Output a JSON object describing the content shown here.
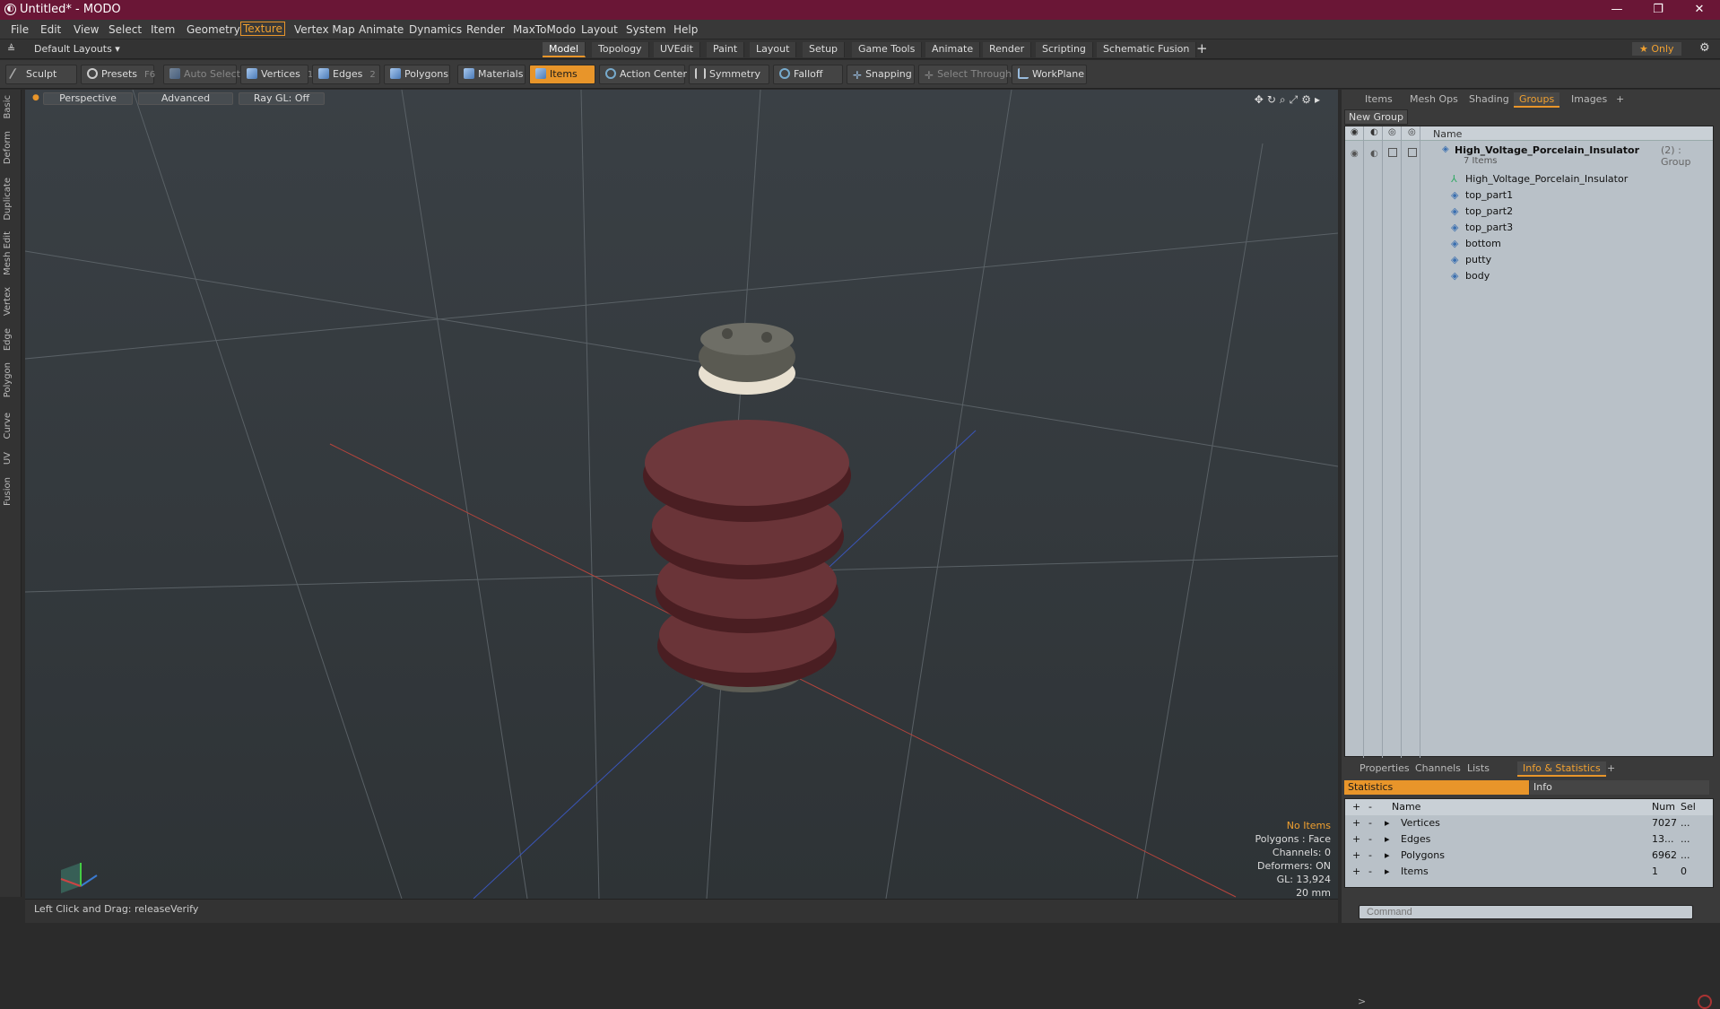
{
  "window": {
    "title": "Untitled* - MODO",
    "min": "—",
    "max": "❐",
    "close": "✕"
  },
  "menu": [
    "File",
    "Edit",
    "View",
    "Select",
    "Item",
    "Geometry",
    "Texture",
    "Vertex Map",
    "Animate",
    "Dynamics",
    "Render",
    "MaxToModo",
    "Layout",
    "System",
    "Help"
  ],
  "layouts": {
    "label": "Default Layouts ▾",
    "tabs": [
      "Model",
      "Topology",
      "UVEdit",
      "Paint",
      "Layout",
      "Setup",
      "Game Tools",
      "Animate",
      "Render",
      "Scripting",
      "Schematic Fusion"
    ],
    "add": "+",
    "only": "★  Only",
    "gear": "⚙"
  },
  "toolbar": {
    "sculpt": "Sculpt",
    "presets": "Presets",
    "presets_key": "F6",
    "auto_select": "Auto Select",
    "vertices": "Vertices",
    "vertices_n": "1",
    "edges": "Edges",
    "edges_n": "2",
    "polygons": "Polygons",
    "materials": "Materials",
    "items": "Items",
    "action_center": "Action Center",
    "symmetry": "Symmetry",
    "falloff": "Falloff",
    "snapping": "Snapping",
    "select_through": "Select Through",
    "workplane": "WorkPlane"
  },
  "left_tabs": [
    "Basic",
    "Deform",
    "Duplicate",
    "Mesh Edit",
    "Vertex",
    "Edge",
    "Polygon",
    "Curve",
    "UV",
    "Fusion"
  ],
  "viewport": {
    "view": "Perspective",
    "shading": "Advanced",
    "raygl": "Ray GL: Off",
    "info": {
      "items": "No Items",
      "polygons": "Polygons : Face",
      "channels": "Channels: 0",
      "deformers": "Deformers: ON",
      "gl": "GL: 13,924",
      "scale": "20 mm"
    }
  },
  "status": {
    "hint": "Left Click and Drag:   releaseVerify"
  },
  "right_tabs": [
    "Items",
    "Mesh Ops",
    "Shading",
    "Groups",
    "Images",
    "+"
  ],
  "groups": {
    "new_group": "New Group",
    "col_name": "Name",
    "group_name": "High_Voltage_Porcelain_Insulator",
    "group_suffix": "(2) : Group",
    "count": "7 Items",
    "items": [
      "High_Voltage_Porcelain_Insulator",
      "top_part1",
      "top_part2",
      "top_part3",
      "bottom",
      "putty",
      "body"
    ]
  },
  "bottom_tabs": [
    "Properties",
    "Channels",
    "Lists",
    "Info & Statistics",
    "+"
  ],
  "stats": {
    "tab_statistics": "Statistics",
    "tab_info": "Info",
    "col_name": "Name",
    "col_num": "Num",
    "col_sel": "Sel",
    "rows": [
      {
        "name": "Vertices",
        "num": "7027",
        "sel": "..."
      },
      {
        "name": "Edges",
        "num": "13...",
        "sel": "..."
      },
      {
        "name": "Polygons",
        "num": "6962",
        "sel": "..."
      },
      {
        "name": "Items",
        "num": "1",
        "sel": "0"
      }
    ]
  },
  "command": {
    "placeholder": "Command"
  }
}
